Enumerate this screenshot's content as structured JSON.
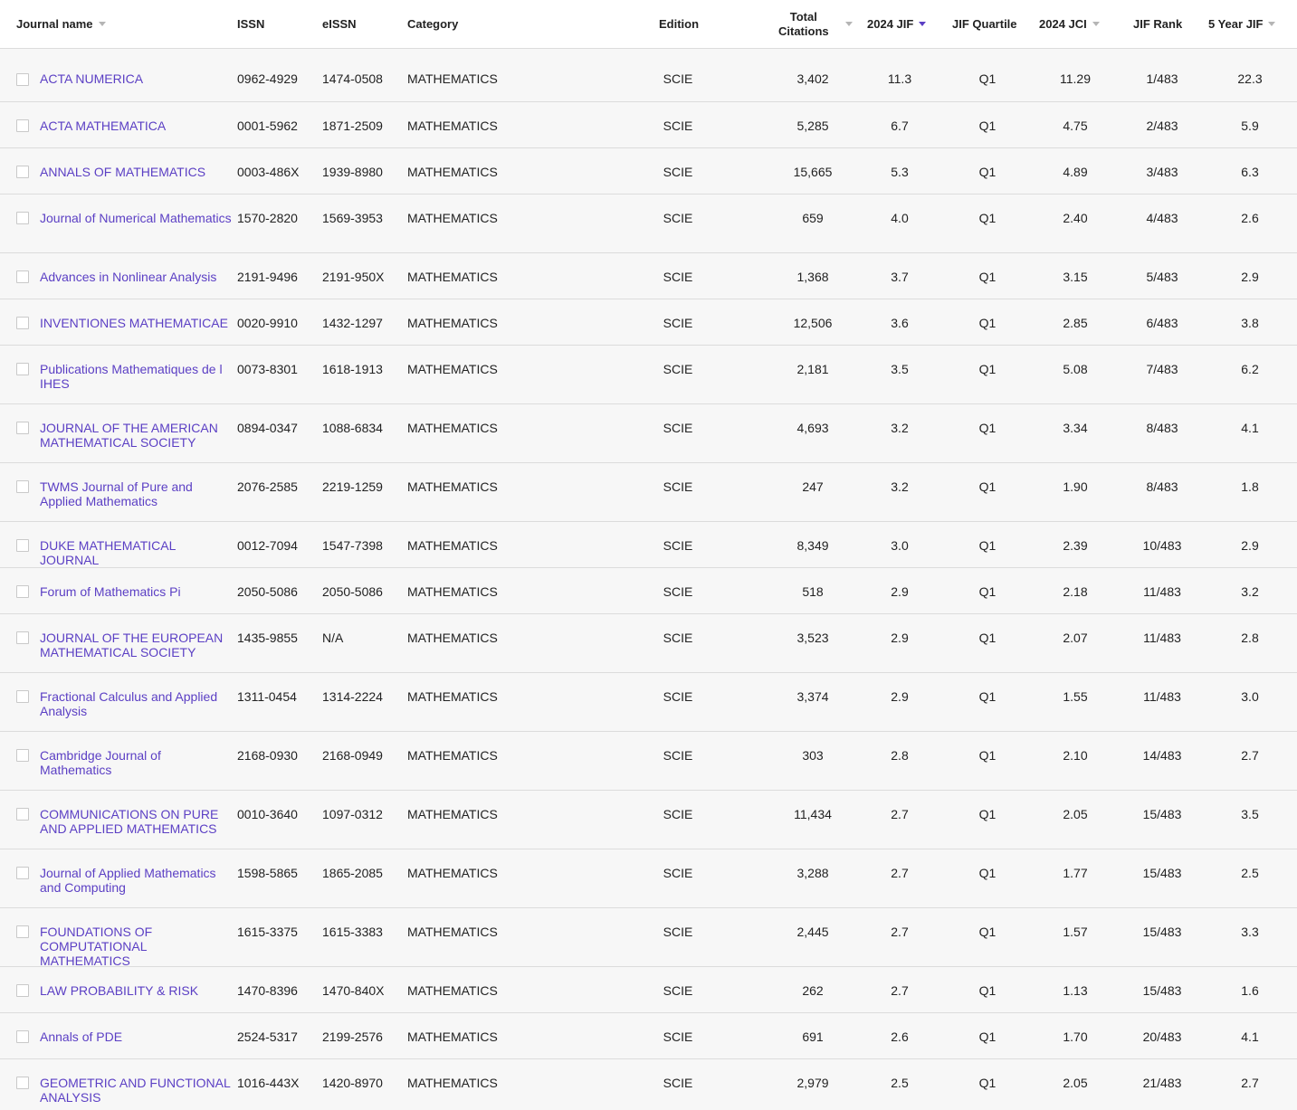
{
  "headers": {
    "journal_name": "Journal name",
    "issn": "ISSN",
    "eissn": "eISSN",
    "category": "Category",
    "edition": "Edition",
    "total_citations_line1": "Total",
    "total_citations_line2": "Citations",
    "jif": "2024 JIF",
    "jif_quartile": "JIF Quartile",
    "jci": "2024 JCI",
    "jif_rank": "JIF Rank",
    "five_year_jif": "5 Year JIF"
  },
  "rows": [
    {
      "name": "ACTA NUMERICA",
      "issn": "0962-4929",
      "eissn": "1474-0508",
      "category": "MATHEMATICS",
      "edition": "SCIE",
      "citations": "3,402",
      "jif": "11.3",
      "quartile": "Q1",
      "jci": "11.29",
      "rank": "1/483",
      "jif5": "22.3"
    },
    {
      "name": "ACTA MATHEMATICA",
      "issn": "0001-5962",
      "eissn": "1871-2509",
      "category": "MATHEMATICS",
      "edition": "SCIE",
      "citations": "5,285",
      "jif": "6.7",
      "quartile": "Q1",
      "jci": "4.75",
      "rank": "2/483",
      "jif5": "5.9"
    },
    {
      "name": "ANNALS OF MATHEMATICS",
      "issn": "0003-486X",
      "eissn": "1939-8980",
      "category": "MATHEMATICS",
      "edition": "SCIE",
      "citations": "15,665",
      "jif": "5.3",
      "quartile": "Q1",
      "jci": "4.89",
      "rank": "3/483",
      "jif5": "6.3"
    },
    {
      "name": "Journal of Numerical Mathematics",
      "issn": "1570-2820",
      "eissn": "1569-3953",
      "category": "MATHEMATICS",
      "edition": "SCIE",
      "citations": "659",
      "jif": "4.0",
      "quartile": "Q1",
      "jci": "2.40",
      "rank": "4/483",
      "jif5": "2.6"
    },
    {
      "name": "Advances in Nonlinear Analysis",
      "issn": "2191-9496",
      "eissn": "2191-950X",
      "category": "MATHEMATICS",
      "edition": "SCIE",
      "citations": "1,368",
      "jif": "3.7",
      "quartile": "Q1",
      "jci": "3.15",
      "rank": "5/483",
      "jif5": "2.9"
    },
    {
      "name": "INVENTIONES MATHEMATICAE",
      "issn": "0020-9910",
      "eissn": "1432-1297",
      "category": "MATHEMATICS",
      "edition": "SCIE",
      "citations": "12,506",
      "jif": "3.6",
      "quartile": "Q1",
      "jci": "2.85",
      "rank": "6/483",
      "jif5": "3.8"
    },
    {
      "name": "Publications Mathematiques de l IHES",
      "issn": "0073-8301",
      "eissn": "1618-1913",
      "category": "MATHEMATICS",
      "edition": "SCIE",
      "citations": "2,181",
      "jif": "3.5",
      "quartile": "Q1",
      "jci": "5.08",
      "rank": "7/483",
      "jif5": "6.2"
    },
    {
      "name": "JOURNAL OF THE AMERICAN MATHEMATICAL SOCIETY",
      "issn": "0894-0347",
      "eissn": "1088-6834",
      "category": "MATHEMATICS",
      "edition": "SCIE",
      "citations": "4,693",
      "jif": "3.2",
      "quartile": "Q1",
      "jci": "3.34",
      "rank": "8/483",
      "jif5": "4.1"
    },
    {
      "name": "TWMS Journal of Pure and Applied Mathematics",
      "issn": "2076-2585",
      "eissn": "2219-1259",
      "category": "MATHEMATICS",
      "edition": "SCIE",
      "citations": "247",
      "jif": "3.2",
      "quartile": "Q1",
      "jci": "1.90",
      "rank": "8/483",
      "jif5": "1.8"
    },
    {
      "name": "DUKE MATHEMATICAL JOURNAL",
      "issn": "0012-7094",
      "eissn": "1547-7398",
      "category": "MATHEMATICS",
      "edition": "SCIE",
      "citations": "8,349",
      "jif": "3.0",
      "quartile": "Q1",
      "jci": "2.39",
      "rank": "10/483",
      "jif5": "2.9"
    },
    {
      "name": "Forum of Mathematics Pi",
      "issn": "2050-5086",
      "eissn": "2050-5086",
      "category": "MATHEMATICS",
      "edition": "SCIE",
      "citations": "518",
      "jif": "2.9",
      "quartile": "Q1",
      "jci": "2.18",
      "rank": "11/483",
      "jif5": "3.2"
    },
    {
      "name": "JOURNAL OF THE EUROPEAN MATHEMATICAL SOCIETY",
      "issn": "1435-9855",
      "eissn": "N/A",
      "category": "MATHEMATICS",
      "edition": "SCIE",
      "citations": "3,523",
      "jif": "2.9",
      "quartile": "Q1",
      "jci": "2.07",
      "rank": "11/483",
      "jif5": "2.8"
    },
    {
      "name": "Fractional Calculus and Applied Analysis",
      "issn": "1311-0454",
      "eissn": "1314-2224",
      "category": "MATHEMATICS",
      "edition": "SCIE",
      "citations": "3,374",
      "jif": "2.9",
      "quartile": "Q1",
      "jci": "1.55",
      "rank": "11/483",
      "jif5": "3.0"
    },
    {
      "name": "Cambridge Journal of Mathematics",
      "issn": "2168-0930",
      "eissn": "2168-0949",
      "category": "MATHEMATICS",
      "edition": "SCIE",
      "citations": "303",
      "jif": "2.8",
      "quartile": "Q1",
      "jci": "2.10",
      "rank": "14/483",
      "jif5": "2.7"
    },
    {
      "name": "COMMUNICATIONS ON PURE AND APPLIED MATHEMATICS",
      "issn": "0010-3640",
      "eissn": "1097-0312",
      "category": "MATHEMATICS",
      "edition": "SCIE",
      "citations": "11,434",
      "jif": "2.7",
      "quartile": "Q1",
      "jci": "2.05",
      "rank": "15/483",
      "jif5": "3.5"
    },
    {
      "name": "Journal of Applied Mathematics and Computing",
      "issn": "1598-5865",
      "eissn": "1865-2085",
      "category": "MATHEMATICS",
      "edition": "SCIE",
      "citations": "3,288",
      "jif": "2.7",
      "quartile": "Q1",
      "jci": "1.77",
      "rank": "15/483",
      "jif5": "2.5"
    },
    {
      "name": "FOUNDATIONS OF COMPUTATIONAL MATHEMATICS",
      "issn": "1615-3375",
      "eissn": "1615-3383",
      "category": "MATHEMATICS",
      "edition": "SCIE",
      "citations": "2,445",
      "jif": "2.7",
      "quartile": "Q1",
      "jci": "1.57",
      "rank": "15/483",
      "jif5": "3.3"
    },
    {
      "name": "LAW PROBABILITY & RISK",
      "issn": "1470-8396",
      "eissn": "1470-840X",
      "category": "MATHEMATICS",
      "edition": "SCIE",
      "citations": "262",
      "jif": "2.7",
      "quartile": "Q1",
      "jci": "1.13",
      "rank": "15/483",
      "jif5": "1.6"
    },
    {
      "name": "Annals of PDE",
      "issn": "2524-5317",
      "eissn": "2199-2576",
      "category": "MATHEMATICS",
      "edition": "SCIE",
      "citations": "691",
      "jif": "2.6",
      "quartile": "Q1",
      "jci": "1.70",
      "rank": "20/483",
      "jif5": "4.1"
    },
    {
      "name": "GEOMETRIC AND FUNCTIONAL ANALYSIS",
      "issn": "1016-443X",
      "eissn": "1420-8970",
      "category": "MATHEMATICS",
      "edition": "SCIE",
      "citations": "2,979",
      "jif": "2.5",
      "quartile": "Q1",
      "jci": "2.05",
      "rank": "21/483",
      "jif5": "2.7"
    }
  ]
}
